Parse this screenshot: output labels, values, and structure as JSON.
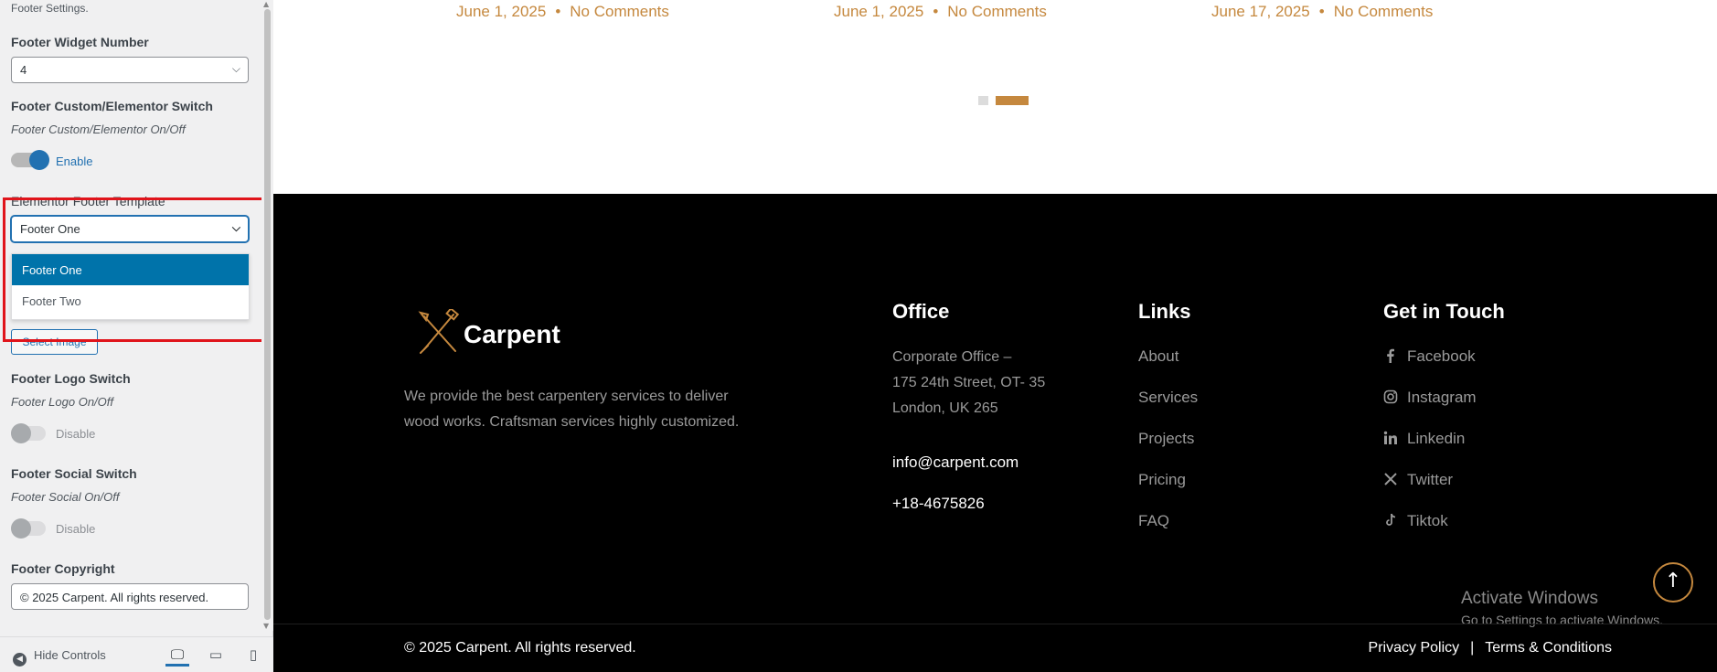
{
  "sidebar": {
    "section_note": "Footer Settings.",
    "widget_number": {
      "title": "Footer Widget Number",
      "value": "4"
    },
    "custom_switch": {
      "title": "Footer Custom/Elementor Switch",
      "desc": "Footer Custom/Elementor On/Off",
      "state_label": "Enable"
    },
    "template": {
      "title": "Elementor Footer Template",
      "value": "Footer One",
      "options": [
        "Footer One",
        "Footer Two"
      ]
    },
    "select_image_label": "Select Image",
    "logo_switch": {
      "title": "Footer Logo Switch",
      "desc": "Footer Logo On/Off",
      "state_label": "Disable"
    },
    "social_switch": {
      "title": "Footer Social Switch",
      "desc": "Footer Social On/Off",
      "state_label": "Disable"
    },
    "copyright": {
      "title": "Footer Copyright",
      "value": "© 2025 Carpent. All rights reserved."
    },
    "hide_controls_label": "Hide Controls"
  },
  "preview": {
    "posts_meta": [
      {
        "date": "June 1, 2025",
        "comments": "No Comments"
      },
      {
        "date": "June 1, 2025",
        "comments": "No Comments"
      },
      {
        "date": "June 17, 2025",
        "comments": "No Comments"
      }
    ],
    "meta_separator": "•",
    "footer": {
      "brand": "Carpent",
      "about": "We provide the best carpentery services to deliver wood works. Craftsman services highly customized.",
      "office": {
        "title": "Office",
        "address_lines": [
          "Corporate Office –",
          "175 24th Street, OT- 35",
          "London, UK 265"
        ],
        "email": "info@carpent.com",
        "phone": "+18-4675826"
      },
      "links": {
        "title": "Links",
        "items": [
          "About",
          "Services",
          "Projects",
          "Pricing",
          "FAQ"
        ]
      },
      "contact": {
        "title": "Get in Touch",
        "items": [
          {
            "label": "Facebook",
            "icon": "facebook-icon"
          },
          {
            "label": "Instagram",
            "icon": "instagram-icon"
          },
          {
            "label": "Linkedin",
            "icon": "linkedin-icon"
          },
          {
            "label": "Twitter",
            "icon": "x-twitter-icon"
          },
          {
            "label": "Tiktok",
            "icon": "tiktok-icon"
          }
        ]
      },
      "copyright": "© 2025 Carpent. All rights reserved.",
      "legal": {
        "privacy": "Privacy Policy",
        "separator": "|",
        "terms": "Terms & Conditions"
      }
    },
    "activate_windows": {
      "title": "Activate Windows",
      "subtitle": "Go to Settings to activate Windows."
    }
  },
  "colors": {
    "accent": "#c5883e",
    "wp_blue": "#2271b1",
    "highlight_red": "#e0141b"
  }
}
